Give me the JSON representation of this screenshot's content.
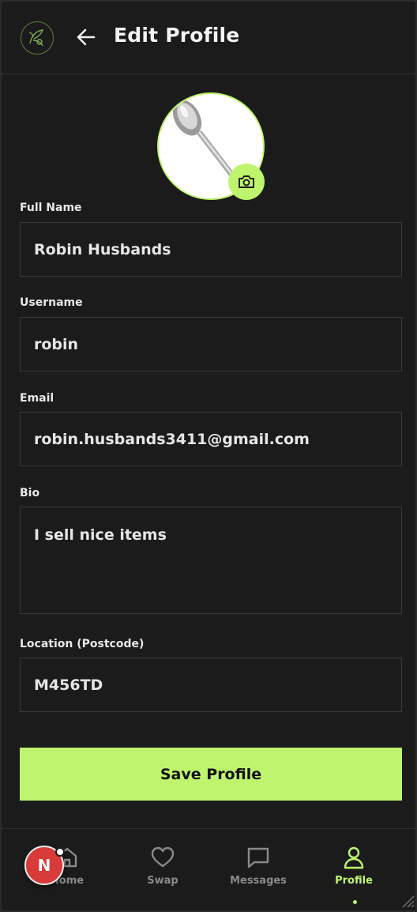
{
  "header": {
    "title": "Edit Profile"
  },
  "form": {
    "full_name": {
      "label": "Full Name",
      "value": "Robin Husbands"
    },
    "username": {
      "label": "Username",
      "value": "robin"
    },
    "email": {
      "label": "Email",
      "value": "robin.husbands3411@gmail.com"
    },
    "bio": {
      "label": "Bio",
      "value": "I sell nice items"
    },
    "location": {
      "label": "Location (Postcode)",
      "value": "M456TD"
    },
    "save_label": "Save Profile"
  },
  "nav": {
    "items": [
      {
        "label": "Home",
        "icon": "home-icon"
      },
      {
        "label": "Swap",
        "icon": "heart-icon"
      },
      {
        "label": "Messages",
        "icon": "message-icon"
      },
      {
        "label": "Profile",
        "icon": "user-icon",
        "active": true
      }
    ]
  },
  "badge": {
    "letter": "N"
  },
  "colors": {
    "accent": "#bff46e",
    "background": "#1b1b1b",
    "badge": "#d93a3a"
  }
}
